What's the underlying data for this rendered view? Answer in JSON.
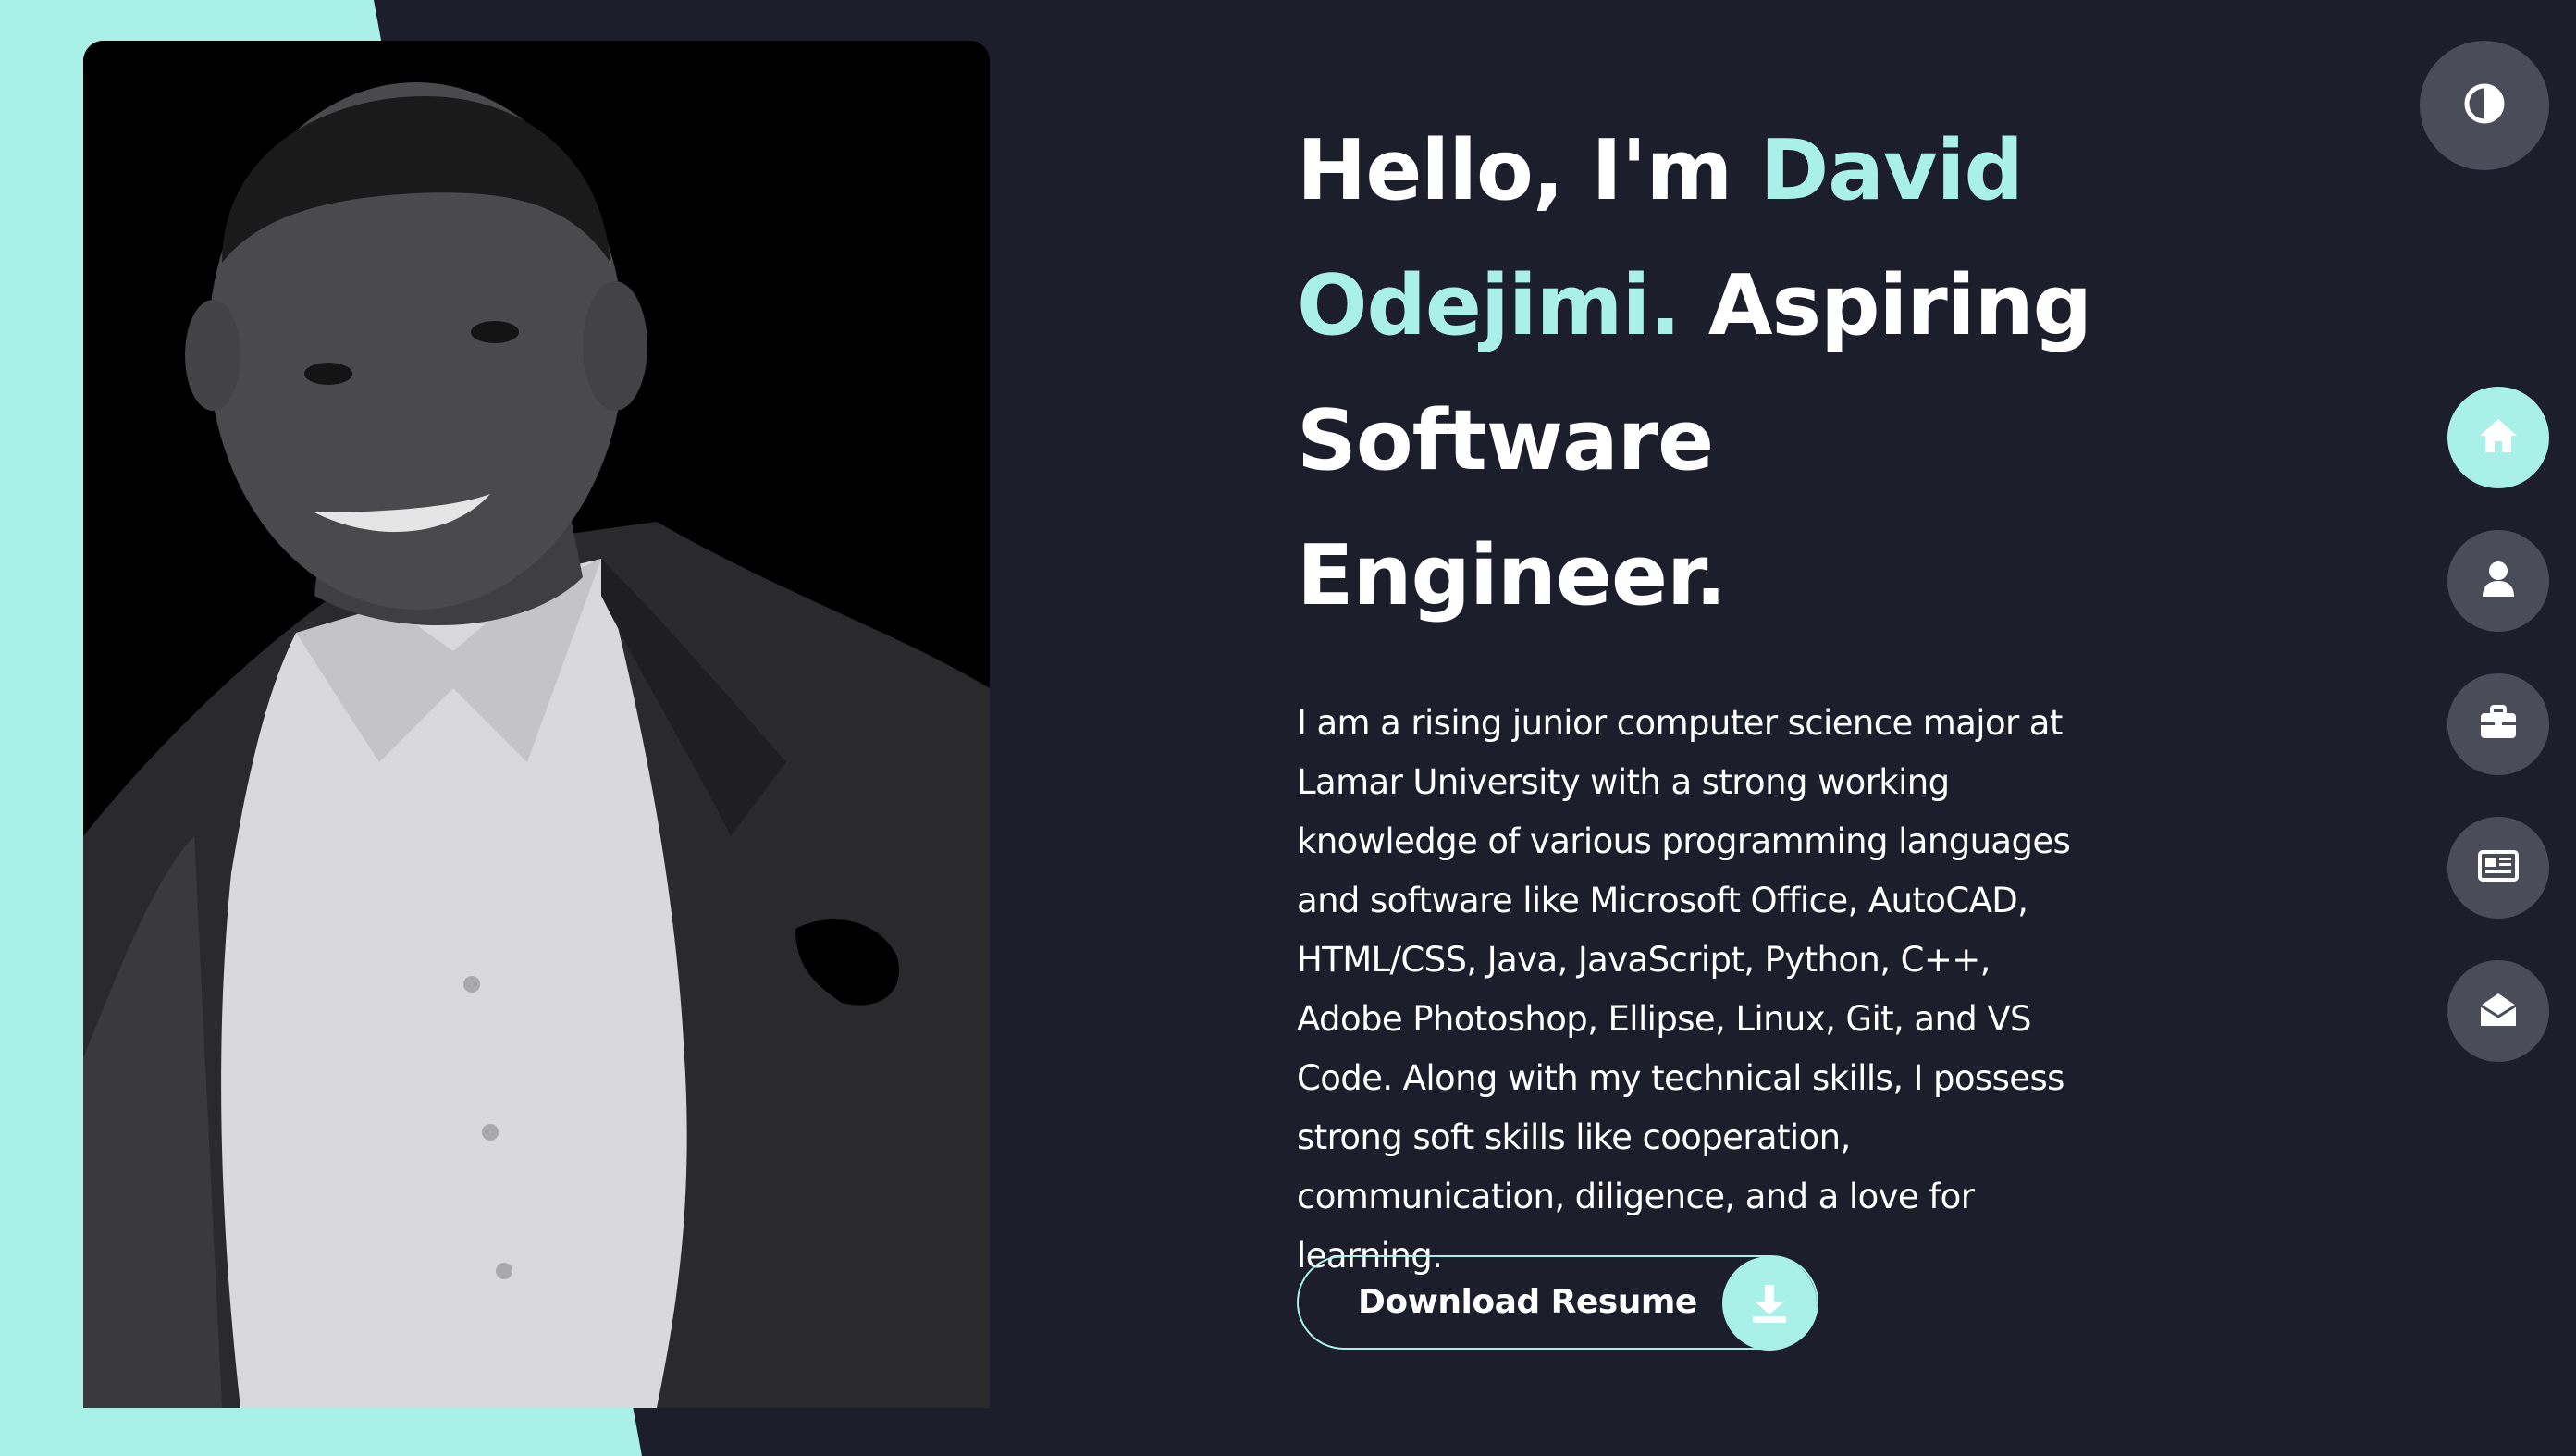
{
  "colors": {
    "background": "#1c1e2b",
    "accent": "#a8f0e8",
    "text": "#ffffff",
    "nav_button": "#4a4d58"
  },
  "hero": {
    "greeting": "Hello, I'm ",
    "name_first": "David",
    "name_last": "Odejimi.",
    "role_line_1": "Aspiring",
    "role_line_2": "Software",
    "role_line_3": "Engineer.",
    "bio": "I am a rising junior computer science major at Lamar University with a strong working knowledge of various programming languages and software like Microsoft Office, AutoCAD, HTML/CSS, Java, JavaScript, Python, C++, Adobe Photoshop, Ellipse, Linux, Git, and VS Code. Along with my technical skills, I possess strong soft skills like cooperation, communication, diligence, and a love for learning."
  },
  "download": {
    "label": "Download Resume",
    "icon": "download-icon"
  },
  "theme_toggle": {
    "icon": "contrast-icon"
  },
  "side_nav": {
    "items": [
      {
        "icon": "home-icon",
        "active": true
      },
      {
        "icon": "user-icon",
        "active": false
      },
      {
        "icon": "briefcase-icon",
        "active": false
      },
      {
        "icon": "newspaper-icon",
        "active": false
      },
      {
        "icon": "envelope-open-icon",
        "active": false
      }
    ]
  }
}
